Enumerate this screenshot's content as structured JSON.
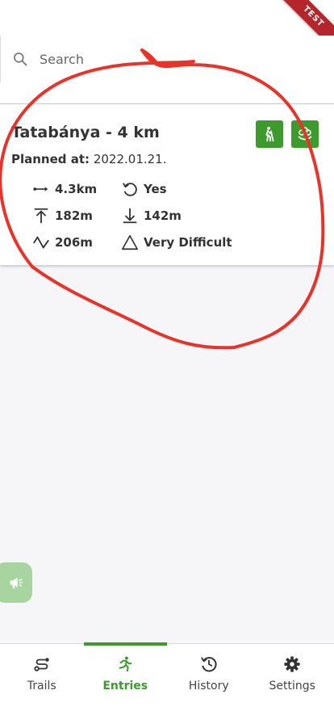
{
  "ribbon": {
    "label": "TEST"
  },
  "search": {
    "placeholder": "Search",
    "icon": "search-icon"
  },
  "entry": {
    "title": "Tatabánya - 4 km",
    "planned_label": "Planned at:",
    "planned_value": "2022.01.21.",
    "badges": [
      "hiker-icon",
      "flower-icon"
    ],
    "stats": {
      "distance": "4.3km",
      "loop": "Yes",
      "ascent": "182m",
      "descent": "142m",
      "elevation": "206m",
      "difficulty": "Very Difficult"
    }
  },
  "nav": {
    "items": [
      {
        "label": "Trails",
        "icon": "route-icon"
      },
      {
        "label": "Entries",
        "icon": "running-icon",
        "active": true
      },
      {
        "label": "History",
        "icon": "history-icon"
      },
      {
        "label": "Settings",
        "icon": "gear-icon"
      }
    ]
  },
  "colors": {
    "accent": "#3d9a2d",
    "ribbon": "#b3262b",
    "annotation": "#e8332b"
  }
}
